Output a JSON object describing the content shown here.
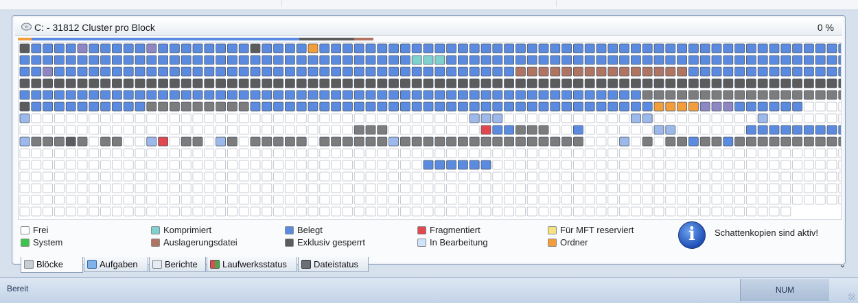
{
  "header": {
    "title": "C: - 31812 Cluster pro Block",
    "percent": "0 %"
  },
  "colors": {
    "frei": "#ffffff",
    "system": "#3cc54a",
    "komprimiert": "#7fd1d0",
    "auslagerungsdatei": "#b07462",
    "belegt": "#5b8be0",
    "exklusiv_gesperrt": "#5c5c5c",
    "fragmentiert": "#e0474f",
    "in_bearbeitung": "#cfe3fb",
    "mft_reserviert": "#f6e27e",
    "ordner": "#f39d3b",
    "belegt_light": "#9db8ea",
    "grey_light": "#c9c9c9"
  },
  "legend": {
    "frei": "Frei",
    "system": "System",
    "komprimiert": "Komprimiert",
    "auslagerungsdatei": "Auslagerungsdatei",
    "belegt": "Belegt",
    "exklusiv_gesperrt": "Exklusiv gesperrt",
    "fragmentiert": "Fragmentiert",
    "in_bearbeitung": "In Bearbeitung",
    "mft_reserviert": "Für MFT reserviert",
    "ordner": "Ordner"
  },
  "info": {
    "icon": "info-icon",
    "message": "Schattenkopien sind aktiv!"
  },
  "tabs": [
    {
      "label": "Blöcke",
      "icon": "blocks-icon"
    },
    {
      "label": "Aufgaben",
      "icon": "tasks-icon"
    },
    {
      "label": "Berichte",
      "icon": "reports-icon"
    },
    {
      "label": "Laufwerksstatus",
      "icon": "drive-status-icon"
    },
    {
      "label": "Dateistatus",
      "icon": "file-status-icon"
    }
  ],
  "status": {
    "left": "Bereit",
    "num": "NUM"
  },
  "block_map": {
    "rows": [
      "GBBBBMBBBBBMBBBBBBBBGBBBBOBBBBBBBBBBBBBBBBBBBBBBBBBBBBBBBBBBBBBBBBBBBBBBBB",
      "BBBBBBBBBBBBBBBBBBBBBBBBBBBBBBBBBBCCCBBBBBBBBBBBBBBBBBBBBBBBBBBBBBBBBBBBBB",
      "BBMBBBBBBBBBBBBBBBBBBBBBBBBBBBBBBBBBBBBBBBBPPPPPPPPPPPPPPPBBBBBBBBBBBBBBBB",
      "GGGGGGGGGGGGGGGGGGGGGGGGGGGGGGGGGGGGGGGGGGGGGGGGGGGGGGGGGGGGGGGGGGGGGGGGGG",
      "BBBBBBBBBBBBBBBBBBBBBBBBBBBBBBBBBBBBBBBBBBBBBBBBBBBBBBDDDDDDDDDDDDDDDDDDDDD",
      "GBBBBBBBBBBDDDDDDDDDBBBBBBBBBBBBBBBBBBBBBBBBBBBBBBBBBBBOOOOMMMBBBBBBWWWWFFFLW",
      "LWWWWWWWWWWWWWWWWWWWWWWWWWWWWWWWWWWWWWWLLLWWWWWWWWWWWLLWWWWWWWWWLWWWWWWWWWW",
      "WWWWWWWWWWWWWWWWWWWWWWWWWWWWWDDDWWWWWWWWFBBDDDWWBWWWWWWLLWWWWWWBBBBBBBBBBBWWW",
      "LDDDGDWDDWWLFWDDWLDWDDDDDWDDDDDDLDDDDDDDDDDDDDDDDWWWLWDWDDBDDBDDDDDDDDDDDDDD",
      "WWWWWWWWWWWWWWWWWWWWWWWWWWWWWWWWWWWWWWWWWWWWWWWWWWWWWWWWWWWWWWWWWWWWWWWWWW",
      "WWWWWWWWWWWWWWWWWWWWWWWWWWWWWWWWWWWBBBBBBWWWWWWWWWWWWWWWWWWWWWWWWWWWWWWWWWW",
      "WWWWWWWWWWWWWWWWWWWWWWWWWWWWWWWWWWWWWWWWWWWWWWWWWWWWWWWWWWWWWWWWWWWWWWWWWW",
      "WWWWWWWWWWWWWWWWWWWWWWWWWWWWWWWWWWWWWWWWWWWWWWWWWWWWWWWWWWWWWWWWWWWWWWWWWW",
      "WWWWWWWWWWWWWWWWWWWWWWWWWWWWWWWWWWWWWWWWWWWWWWWWWWWWWWWWWWWWWWWWWWWWWWWWWW",
      "WWWWWWWWWWWWWWWWWWWWWWWWWWWWWWWWWWWWWWWWWWWWWWWWWWWWWWWWWWWWWWWWWWWWWWWWWW"
    ],
    "last_row_count": 67
  }
}
